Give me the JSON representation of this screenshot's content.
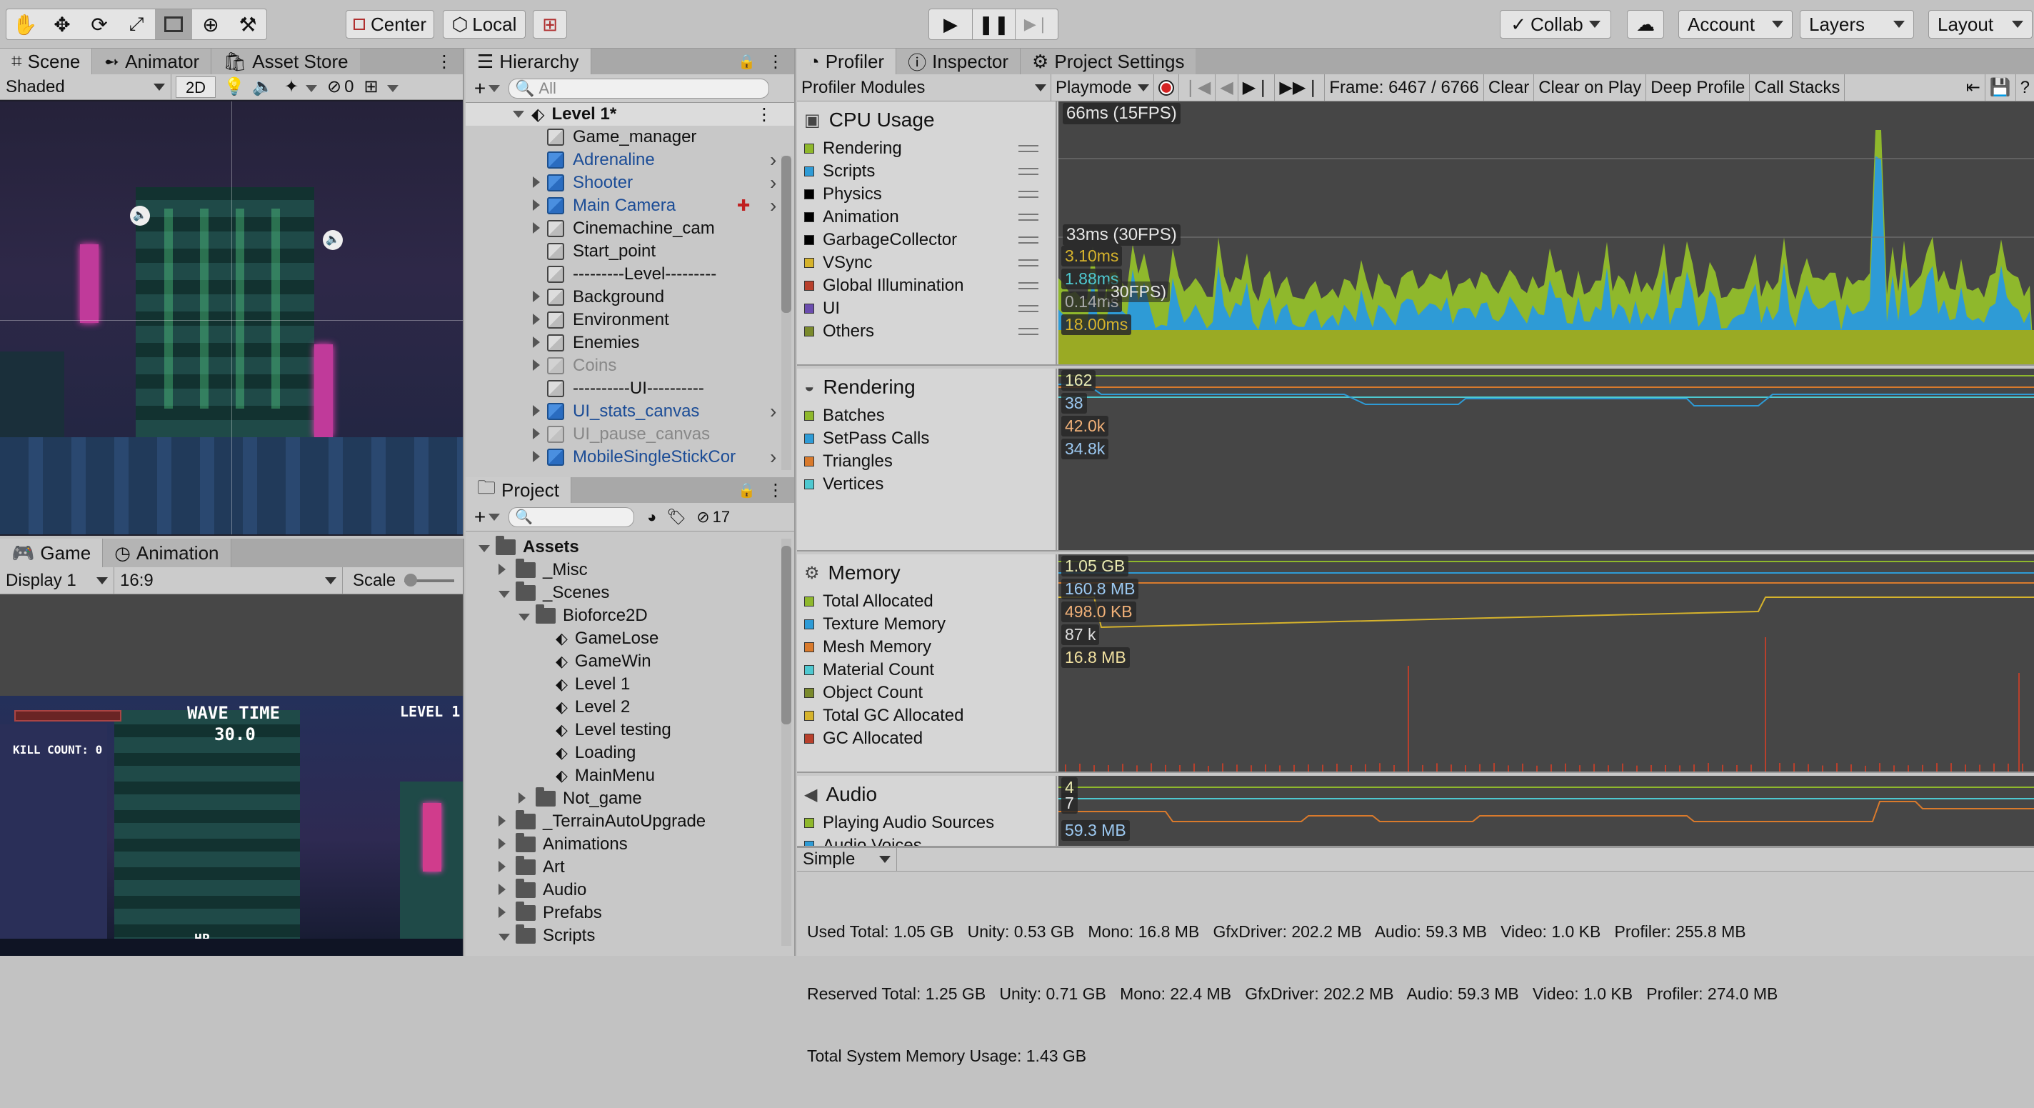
{
  "toolbar": {
    "center_label": "Center",
    "local_label": "Local",
    "collab_label": "Collab",
    "account_label": "Account",
    "layers_label": "Layers",
    "layout_label": "Layout"
  },
  "scene_panel": {
    "tabs": [
      "Scene",
      "Animator",
      "Asset Store"
    ],
    "shading_mode": "Shaded",
    "mode_2d": "2D",
    "hidden_count": "0"
  },
  "game_panel": {
    "tabs": [
      "Game",
      "Animation"
    ],
    "display": "Display 1",
    "aspect": "16:9",
    "scale_label": "Scale",
    "hud": {
      "wave_title": "WAVE TIME",
      "wave_value": "30.0",
      "level": "LEVEL 1",
      "kill_count": "KILL COUNT: 0",
      "bottom_label": "HP"
    }
  },
  "hierarchy": {
    "title": "Hierarchy",
    "search_placeholder": "All",
    "scene_name": "Level 1*",
    "items": [
      {
        "label": "Game_manager",
        "type": "plain",
        "arrow": false,
        "indent": 1
      },
      {
        "label": "Adrenaline",
        "type": "prefab",
        "arrow": false,
        "indent": 1,
        "more": true
      },
      {
        "label": "Shooter",
        "type": "prefab",
        "arrow": true,
        "indent": 1,
        "more": true
      },
      {
        "label": "Main Camera",
        "type": "prefab",
        "arrow": true,
        "indent": 1,
        "more": true
      },
      {
        "label": "Cinemachine_cam",
        "type": "plain",
        "arrow": true,
        "indent": 1
      },
      {
        "label": "Start_point",
        "type": "plain",
        "arrow": false,
        "indent": 1
      },
      {
        "label": "---------Level---------",
        "type": "plain",
        "arrow": false,
        "indent": 1
      },
      {
        "label": "Background",
        "type": "plain",
        "arrow": true,
        "indent": 1
      },
      {
        "label": "Environment",
        "type": "plain",
        "arrow": true,
        "indent": 1
      },
      {
        "label": "Enemies",
        "type": "plain",
        "arrow": true,
        "indent": 1
      },
      {
        "label": "Coins",
        "type": "disabled",
        "arrow": true,
        "indent": 1
      },
      {
        "label": "----------UI----------",
        "type": "plain",
        "arrow": false,
        "indent": 1
      },
      {
        "label": "UI_stats_canvas",
        "type": "prefab",
        "arrow": true,
        "indent": 1,
        "more": true
      },
      {
        "label": "UI_pause_canvas",
        "type": "disabled",
        "arrow": true,
        "indent": 1
      },
      {
        "label": "MobileSingleStickCor",
        "type": "prefab",
        "arrow": true,
        "indent": 1,
        "more": true
      }
    ]
  },
  "project": {
    "title": "Project",
    "hidden_count": "17",
    "items": [
      {
        "label": "Assets",
        "type": "folder",
        "expanded": true,
        "indent": 0,
        "bold": true
      },
      {
        "label": "_Misc",
        "type": "folder",
        "expanded": false,
        "indent": 1
      },
      {
        "label": "_Scenes",
        "type": "folder",
        "expanded": true,
        "indent": 1
      },
      {
        "label": "Bioforce2D",
        "type": "folder",
        "expanded": true,
        "indent": 2
      },
      {
        "label": "GameLose",
        "type": "scene",
        "indent": 3
      },
      {
        "label": "GameWin",
        "type": "scene",
        "indent": 3
      },
      {
        "label": "Level 1",
        "type": "scene",
        "indent": 3
      },
      {
        "label": "Level 2",
        "type": "scene",
        "indent": 3
      },
      {
        "label": "Level testing",
        "type": "scene",
        "indent": 3
      },
      {
        "label": "Loading",
        "type": "scene",
        "indent": 3
      },
      {
        "label": "MainMenu",
        "type": "scene",
        "indent": 3
      },
      {
        "label": "Not_game",
        "type": "folder",
        "expanded": false,
        "indent": 2
      },
      {
        "label": "_TerrainAutoUpgrade",
        "type": "folder",
        "expanded": false,
        "indent": 1
      },
      {
        "label": "Animations",
        "type": "folder",
        "expanded": false,
        "indent": 1
      },
      {
        "label": "Art",
        "type": "folder",
        "expanded": false,
        "indent": 1
      },
      {
        "label": "Audio",
        "type": "folder",
        "expanded": false,
        "indent": 1
      },
      {
        "label": "Prefabs",
        "type": "folder",
        "expanded": false,
        "indent": 1
      },
      {
        "label": "Scripts",
        "type": "folder",
        "expanded": true,
        "indent": 1
      }
    ]
  },
  "profiler": {
    "tabs": [
      "Profiler",
      "Inspector",
      "Project Settings"
    ],
    "modules_label": "Profiler Modules",
    "mode": "Playmode",
    "frame_label": "Frame: 6467 / 6766",
    "clear_label": "Clear",
    "clear_on_play_label": "Clear on Play",
    "deep_profile_label": "Deep Profile",
    "call_stacks_label": "Call Stacks",
    "view_mode": "Simple",
    "modules": [
      {
        "title": "CPU Usage",
        "icon": "cpu-icon",
        "legend": [
          {
            "name": "Rendering",
            "color": "#8fb82c"
          },
          {
            "name": "Scripts",
            "color": "#2e9bd6"
          },
          {
            "name": "Physics",
            "color": "#000000"
          },
          {
            "name": "Animation",
            "color": "#000000"
          },
          {
            "name": "GarbageCollector",
            "color": "#000000"
          },
          {
            "name": "VSync",
            "color": "#d6b32c"
          },
          {
            "name": "Global Illumination",
            "color": "#b8402c"
          },
          {
            "name": "UI",
            "color": "#6b4dae"
          },
          {
            "name": "Others",
            "color": "#7a8a2c"
          }
        ],
        "values": [
          "66ms (15FPS)",
          "33ms (30FPS)",
          "3.10ms",
          "1.88ms",
          "0.14ms",
          "18.00ms",
          "30FPS)"
        ]
      },
      {
        "title": "Rendering",
        "icon": "rendering-icon",
        "legend": [
          {
            "name": "Batches",
            "color": "#8fb82c"
          },
          {
            "name": "SetPass Calls",
            "color": "#2e9bd6"
          },
          {
            "name": "Triangles",
            "color": "#d97a2c"
          },
          {
            "name": "Vertices",
            "color": "#4ec8d0"
          }
        ],
        "values": [
          "162",
          "38",
          "42.0k",
          "34.8k"
        ]
      },
      {
        "title": "Memory",
        "icon": "memory-icon",
        "legend": [
          {
            "name": "Total Allocated",
            "color": "#8fb82c"
          },
          {
            "name": "Texture Memory",
            "color": "#2e9bd6"
          },
          {
            "name": "Mesh Memory",
            "color": "#d97a2c"
          },
          {
            "name": "Material Count",
            "color": "#4ec8d0"
          },
          {
            "name": "Object Count",
            "color": "#7a8a2c"
          },
          {
            "name": "Total GC Allocated",
            "color": "#d6b32c"
          },
          {
            "name": "GC Allocated",
            "color": "#b8402c"
          }
        ],
        "values": [
          "1.05 GB",
          "160.8 MB",
          "498.0 KB",
          "87 k",
          "16.8 MB"
        ]
      },
      {
        "title": "Audio",
        "icon": "audio-icon",
        "legend": [
          {
            "name": "Playing Audio Sources",
            "color": "#8fb82c"
          },
          {
            "name": "Audio Voices",
            "color": "#2e9bd6"
          }
        ],
        "values": [
          "4",
          "7",
          "59.3 MB"
        ]
      }
    ],
    "stats": [
      "Used Total: 1.05 GB   Unity: 0.53 GB   Mono: 16.8 MB   GfxDriver: 202.2 MB   Audio: 59.3 MB   Video: 1.0 KB   Profiler: 255.8 MB",
      "Reserved Total: 1.25 GB   Unity: 0.71 GB   Mono: 22.4 MB   GfxDriver: 202.2 MB   Audio: 59.3 MB   Video: 1.0 KB   Profiler: 274.0 MB",
      "Total System Memory Usage: 1.43 GB"
    ]
  }
}
